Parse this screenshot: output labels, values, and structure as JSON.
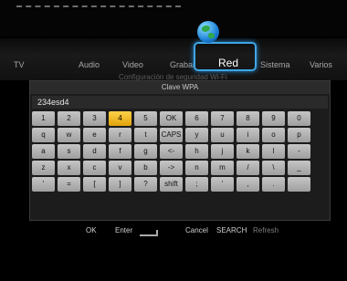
{
  "menu": {
    "items": [
      "TV",
      "Audio",
      "Video",
      "Grabar",
      "Red",
      "Sistema",
      "Varios"
    ],
    "active": "Red",
    "ghost_text": "Configuración de seguridad Wi-Fi"
  },
  "dialog": {
    "title": "Clave WPA",
    "input_value": "234esd4",
    "selected_key": "4",
    "rows": [
      [
        "1",
        "2",
        "3",
        "4",
        "5",
        "OK",
        "6",
        "7",
        "8",
        "9",
        "0"
      ],
      [
        "q",
        "w",
        "e",
        "r",
        "t",
        "CAPS",
        "y",
        "u",
        "i",
        "o",
        "p"
      ],
      [
        "a",
        "s",
        "d",
        "f",
        "g",
        "<-",
        "h",
        "j",
        "k",
        "l",
        "-"
      ],
      [
        "z",
        "x",
        "c",
        "v",
        "b",
        "->",
        "n",
        "m",
        "/",
        "\\",
        "_"
      ],
      [
        "'",
        "=",
        "[",
        "]",
        "?",
        "shift",
        ";",
        "'",
        ",",
        ".",
        ""
      ]
    ]
  },
  "footer": {
    "ok": "OK",
    "enter": "Enter",
    "cancel": "Cancel",
    "search": "SEARCH",
    "refresh": "Refresh"
  }
}
